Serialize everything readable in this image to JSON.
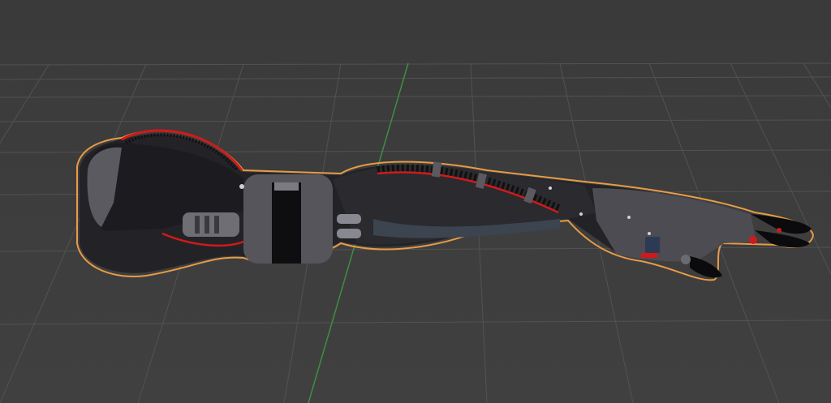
{
  "viewport": {
    "background": "#3d3d3d",
    "grid_color": "#555555",
    "axis_y_color": "#3f8f3f"
  },
  "object": {
    "name": "robotic-arm",
    "selection_outline_color": "#e79b47",
    "accent_color": "#d01a1a",
    "body_color": "#232327",
    "plate_color": "#55555b"
  }
}
